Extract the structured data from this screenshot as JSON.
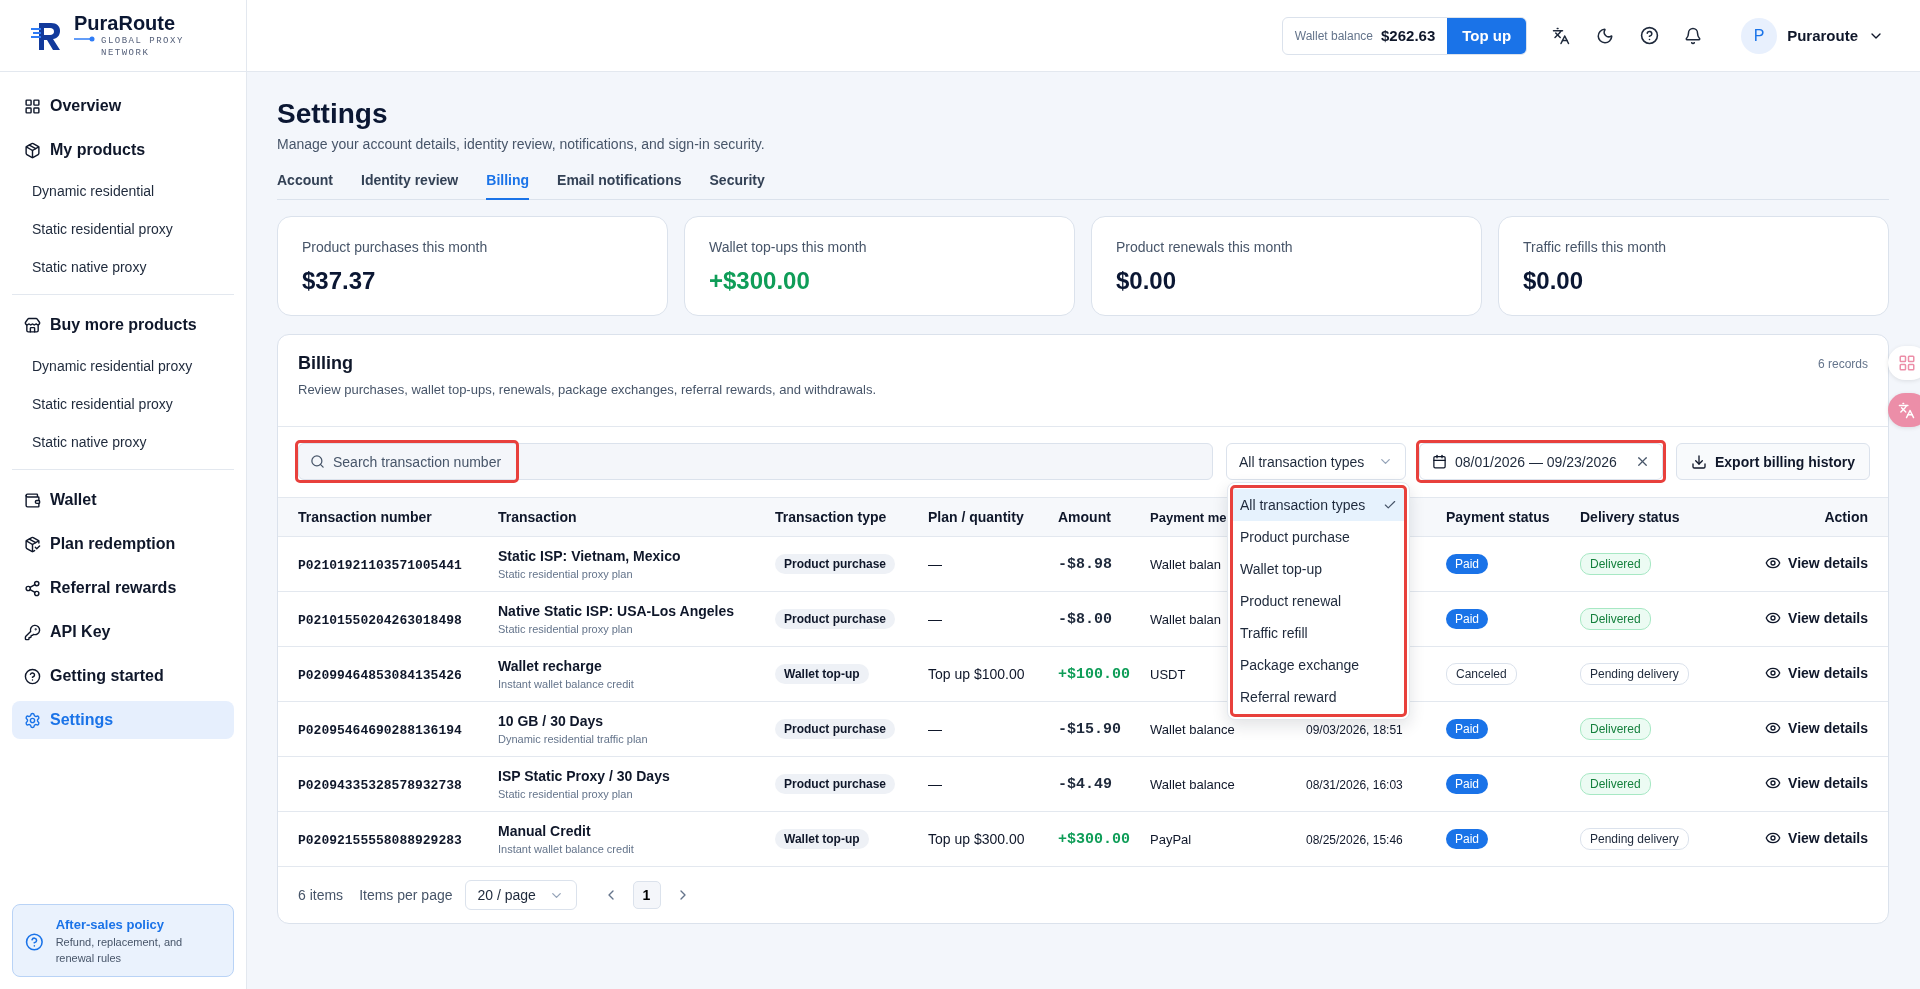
{
  "sidebar": {
    "logo": {
      "name": "PuraRoute",
      "tagline": "GLOBAL PROXY NETWORK"
    },
    "items": [
      {
        "label": "Overview",
        "selected": false
      },
      {
        "label": "My products",
        "selected": false,
        "children": [
          {
            "label": "Dynamic residential",
            "selected": false
          },
          {
            "label": "Static residential proxy",
            "selected": false
          },
          {
            "label": "Static native proxy",
            "selected": false
          }
        ]
      },
      {
        "label": "Buy more products",
        "selected": false,
        "children": [
          {
            "label": "Dynamic residential proxy",
            "selected": false
          },
          {
            "label": "Static residential proxy",
            "selected": false
          },
          {
            "label": "Static native proxy",
            "selected": false
          }
        ]
      },
      {
        "label": "Wallet",
        "selected": false
      },
      {
        "label": "Plan redemption",
        "selected": false
      },
      {
        "label": "Referral rewards",
        "selected": false
      },
      {
        "label": "API Key",
        "selected": false
      },
      {
        "label": "Getting started",
        "selected": false
      },
      {
        "label": "Settings",
        "selected": true
      }
    ],
    "after_sales": {
      "title": "After-sales policy",
      "text": "Refund, replacement, and renewal rules"
    }
  },
  "header": {
    "wallet": {
      "label": "Wallet balance",
      "amount": "$262.63",
      "button": "Top up"
    },
    "user": {
      "initial": "P",
      "name": "Puraroute"
    }
  },
  "page": {
    "title": "Settings",
    "subtitle": "Manage your account details, identity review, notifications, and sign-in security.",
    "tabs": [
      {
        "label": "Account",
        "selected": false
      },
      {
        "label": "Identity review",
        "selected": false
      },
      {
        "label": "Billing",
        "selected": true
      },
      {
        "label": "Email notifications",
        "selected": false
      },
      {
        "label": "Security",
        "selected": false
      }
    ]
  },
  "stats": [
    {
      "label": "Product purchases this month",
      "value": "$37.37",
      "positive": false
    },
    {
      "label": "Wallet top-ups this month",
      "value": "+$300.00",
      "positive": true
    },
    {
      "label": "Product renewals this month",
      "value": "$0.00",
      "positive": false
    },
    {
      "label": "Traffic refills this month",
      "value": "$0.00",
      "positive": false
    }
  ],
  "billing": {
    "title": "Billing",
    "description": "Review purchases, wallet top-ups, renewals, package exchanges, referral rewards, and withdrawals.",
    "count": "6 records",
    "search": {
      "placeholder": "Search transaction number",
      "highlighted": true
    },
    "type_filter": {
      "value": "All transaction types"
    },
    "date_range": {
      "value": "08/01/2026 — 09/23/2026",
      "highlighted": true
    },
    "export_button": "Export billing history",
    "dropdown": {
      "highlighted": true,
      "options": [
        {
          "label": "All transaction types",
          "selected": true
        },
        {
          "label": "Product purchase",
          "selected": false
        },
        {
          "label": "Wallet top-up",
          "selected": false
        },
        {
          "label": "Product renewal",
          "selected": false
        },
        {
          "label": "Traffic refill",
          "selected": false
        },
        {
          "label": "Package exchange",
          "selected": false
        },
        {
          "label": "Referral reward",
          "selected": false
        }
      ]
    },
    "columns": {
      "transaction_number": "Transaction number",
      "transaction": "Transaction",
      "transaction_type": "Transaction type",
      "plan": "Plan / quantity",
      "amount": "Amount",
      "payment_method": "Payment me",
      "payment_status": "Payment status",
      "delivery_status": "Delivery status",
      "action": "Action"
    },
    "rows": [
      {
        "number": "P02101921103571005441",
        "title": "Static ISP: Vietnam, Mexico",
        "subtitle": "Static residential proxy plan",
        "type": "Product purchase",
        "plan": "—",
        "amount": "-$8.98",
        "positive": false,
        "payment_method": "Wallet balan",
        "payment_status": {
          "label": "Paid",
          "kind": "paid"
        },
        "delivery_status": {
          "label": "Delivered",
          "kind": "delivered"
        },
        "action": "View details"
      },
      {
        "number": "P02101550204263018498",
        "title": "Native Static ISP: USA-Los Angeles",
        "subtitle": "Static residential proxy plan",
        "type": "Product purchase",
        "plan": "—",
        "amount": "-$8.00",
        "positive": false,
        "payment_method": "Wallet balan",
        "payment_status": {
          "label": "Paid",
          "kind": "paid"
        },
        "delivery_status": {
          "label": "Delivered",
          "kind": "delivered"
        },
        "action": "View details"
      },
      {
        "number": "P02099464853084135426",
        "title": "Wallet recharge",
        "subtitle": "Instant wallet balance credit",
        "type": "Wallet top-up",
        "plan": "Top up $100.00",
        "amount": "+$100.00",
        "positive": true,
        "payment_method": "USDT",
        "payment_status": {
          "label": "Canceled",
          "kind": "canceled"
        },
        "delivery_status": {
          "label": "Pending delivery",
          "kind": "pending"
        },
        "action": "View details"
      },
      {
        "number": "P02095464690288136194",
        "title": "10 GB / 30 Days",
        "subtitle": "Dynamic residential traffic plan",
        "type": "Product purchase",
        "plan": "—",
        "amount": "-$15.90",
        "positive": false,
        "payment_method": "Wallet balance",
        "created": "09/03/2026, 18:51",
        "payment_status": {
          "label": "Paid",
          "kind": "paid"
        },
        "delivery_status": {
          "label": "Delivered",
          "kind": "delivered"
        },
        "action": "View details"
      },
      {
        "number": "P02094335328578932738",
        "title": "ISP Static Proxy / 30 Days",
        "subtitle": "Static residential proxy plan",
        "type": "Product purchase",
        "plan": "—",
        "amount": "-$4.49",
        "positive": false,
        "payment_method": "Wallet balance",
        "created": "08/31/2026, 16:03",
        "payment_status": {
          "label": "Paid",
          "kind": "paid"
        },
        "delivery_status": {
          "label": "Delivered",
          "kind": "delivered"
        },
        "action": "View details"
      },
      {
        "number": "P02092155558088929283",
        "title": "Manual Credit",
        "subtitle": "Instant wallet balance credit",
        "type": "Wallet top-up",
        "plan": "Top up $300.00",
        "amount": "+$300.00",
        "positive": true,
        "payment_method": "PayPal",
        "created": "08/25/2026, 15:46",
        "payment_status": {
          "label": "Paid",
          "kind": "paid"
        },
        "delivery_status": {
          "label": "Pending delivery",
          "kind": "pending"
        },
        "action": "View details"
      }
    ],
    "footer": {
      "total": "6 items",
      "per_page_label": "Items per page",
      "per_page": "20 / page",
      "pages": [
        {
          "label": "1",
          "selected": true
        }
      ]
    }
  }
}
